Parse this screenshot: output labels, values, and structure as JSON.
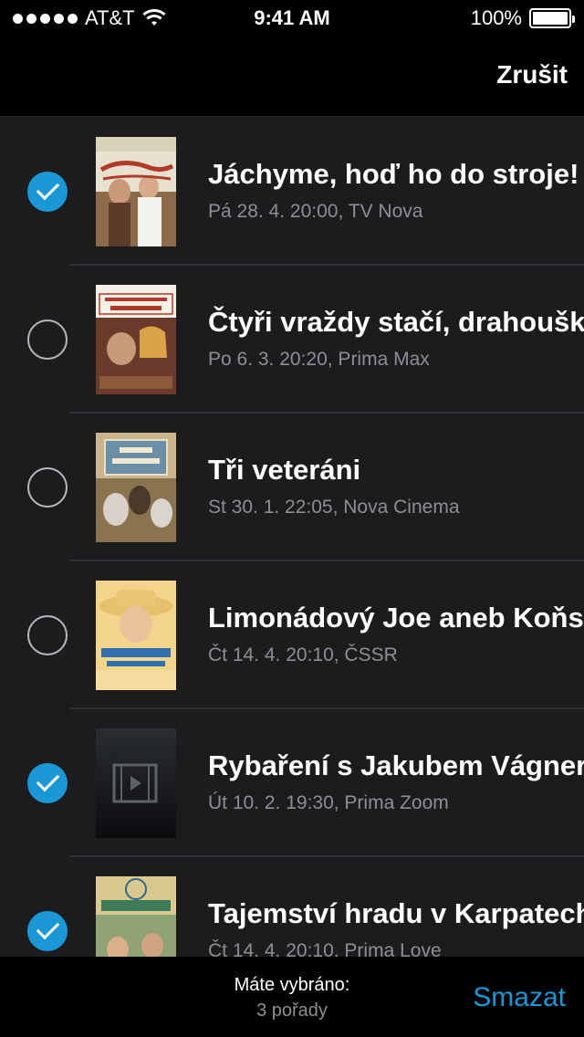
{
  "status_bar": {
    "carrier": "AT&T",
    "time": "9:41 AM",
    "battery_percent": "100%",
    "battery_level": 1.0
  },
  "nav": {
    "cancel_label": "Zrušit"
  },
  "items": [
    {
      "title": "Jáchyme, hoď ho do stroje!",
      "meta": "Pá 28. 4. 20:00, TV Nova",
      "selected": true,
      "poster": "poster-jachyme"
    },
    {
      "title": "Čtyři vraždy stačí, drahoušku",
      "meta": "Po 6. 3. 20:20, Prima Max",
      "selected": false,
      "poster": "poster-ctyri-vrazdy"
    },
    {
      "title": "Tři veteráni",
      "meta": "St 30. 1. 22:05, Nova Cinema",
      "selected": false,
      "poster": "poster-tri-veterani"
    },
    {
      "title": "Limonádový Joe aneb Koňská opera",
      "meta": "Čt 14. 4. 20:10, ČSSR",
      "selected": false,
      "poster": "poster-limonadovy-joe"
    },
    {
      "title": "Rybaření s Jakubem Vágnerem",
      "meta": "Út 10. 2. 19:30, Prima Zoom",
      "selected": true,
      "poster": "video-placeholder-icon"
    },
    {
      "title": "Tajemství hradu v Karpatech",
      "meta": "Čt 14. 4. 20:10, Prima Love",
      "selected": true,
      "poster": "poster-tajemstvi-hradu"
    }
  ],
  "footer": {
    "selected_label": "Máte vybráno:",
    "selected_count": "3 pořady",
    "delete_label": "Smazat"
  },
  "colors": {
    "accent": "#1a98d5",
    "background": "#1c1c1e",
    "bars": "#000000",
    "secondary_text": "#8e8e93"
  }
}
